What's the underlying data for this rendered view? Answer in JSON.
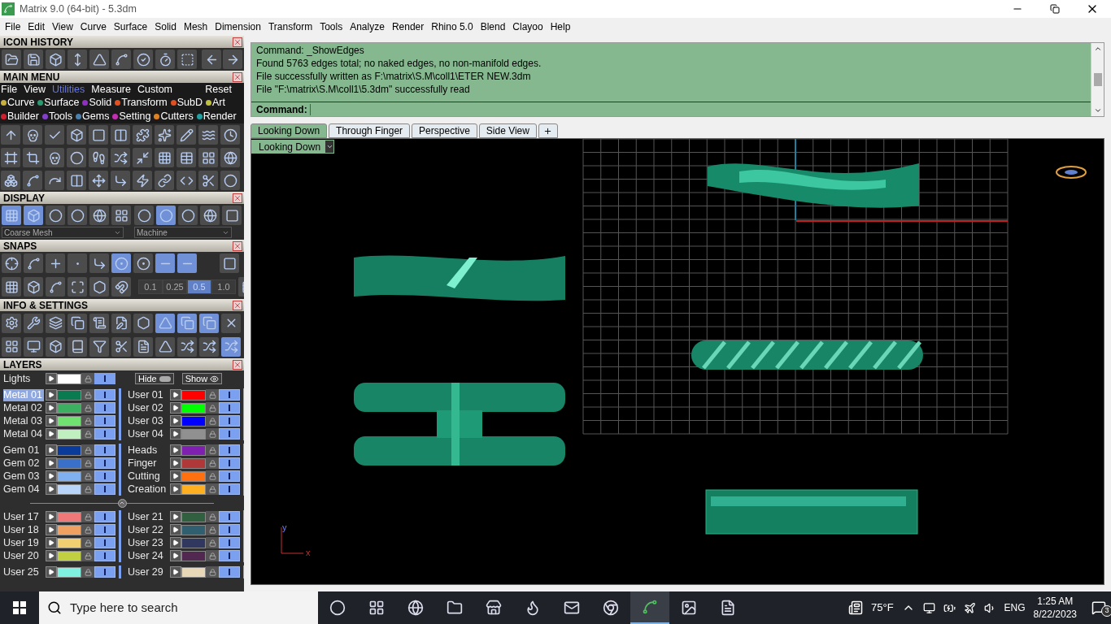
{
  "window": {
    "title": "Matrix 9.0 (64-bit) - 5.3dm"
  },
  "menu_bar": [
    "File",
    "Edit",
    "View",
    "Curve",
    "Surface",
    "Solid",
    "Mesh",
    "Dimension",
    "Transform",
    "Tools",
    "Analyze",
    "Render",
    "Rhino 5.0",
    "Blend",
    "Clayoo",
    "Help"
  ],
  "left_panel": {
    "icon_history": {
      "title": "ICON HISTORY"
    },
    "main_menu": {
      "title": "MAIN MENU",
      "tabs": [
        {
          "label": "File",
          "selected": false
        },
        {
          "label": "View",
          "selected": false
        },
        {
          "label": "Utilities",
          "selected": true
        },
        {
          "label": "Measure",
          "selected": false
        },
        {
          "label": "Custom",
          "selected": false
        }
      ],
      "reset": "Reset",
      "categories": [
        [
          {
            "label": "Curve",
            "color": "#c8b040"
          },
          {
            "label": "Surface",
            "color": "#2a9a70"
          },
          {
            "label": "Solid",
            "color": "#9030c0"
          },
          {
            "label": "Transform",
            "color": "#e05020"
          },
          {
            "label": "SubD",
            "color": "#e05020"
          },
          {
            "label": "Art",
            "color": "#c0c040"
          }
        ],
        [
          {
            "label": "Builder",
            "color": "#d02030"
          },
          {
            "label": "Tools",
            "color": "#8040c8"
          },
          {
            "label": "Gems",
            "color": "#4a80b0"
          },
          {
            "label": "Setting",
            "color": "#c030b0"
          },
          {
            "label": "Cutters",
            "color": "#e08020"
          },
          {
            "label": "Render",
            "color": "#20a0a0"
          }
        ]
      ]
    },
    "display": {
      "title": "DISPLAY",
      "dropdowns": [
        "Coarse Mesh",
        "Machine"
      ]
    },
    "snaps": {
      "title": "SNAPS",
      "values": [
        {
          "label": "0.1",
          "selected": false
        },
        {
          "label": "0.25",
          "selected": false
        },
        {
          "label": "0.5",
          "selected": true
        },
        {
          "label": "1.0",
          "selected": false
        }
      ]
    },
    "info": {
      "title": "INFO & SETTINGS"
    },
    "layers": {
      "title": "LAYERS",
      "lights": {
        "label": "Lights",
        "color": "#ffffff",
        "visible": true
      },
      "hide": "Hide",
      "show": "Show",
      "groups": [
        {
          "left": [
            {
              "name": "Metal 01",
              "color": "#0a7a50",
              "selected": true,
              "visible": true
            },
            {
              "name": "Metal 02",
              "color": "#3cb060",
              "selected": false,
              "visible": true
            },
            {
              "name": "Metal 03",
              "color": "#70e070",
              "selected": false,
              "visible": true
            },
            {
              "name": "Metal 04",
              "color": "#c0f0c0",
              "selected": false,
              "visible": true
            }
          ],
          "right": [
            {
              "name": "User 01",
              "color": "#ff0000",
              "selected": false,
              "visible": true
            },
            {
              "name": "User 02",
              "color": "#00ff00",
              "selected": false,
              "visible": true
            },
            {
              "name": "User 03",
              "color": "#0000ff",
              "selected": false,
              "visible": true
            },
            {
              "name": "User 04",
              "color": "#909090",
              "selected": false,
              "visible": true
            }
          ]
        },
        {
          "left": [
            {
              "name": "Gem 01",
              "color": "#0a3a9a",
              "selected": false,
              "visible": true
            },
            {
              "name": "Gem 02",
              "color": "#3a70c8",
              "selected": false,
              "visible": true
            },
            {
              "name": "Gem 03",
              "color": "#80b0f0",
              "selected": false,
              "visible": true
            },
            {
              "name": "Gem 04",
              "color": "#b8d4f8",
              "selected": false,
              "visible": true
            }
          ],
          "right": [
            {
              "name": "Heads",
              "color": "#8020b0",
              "selected": false,
              "visible": true
            },
            {
              "name": "Finger",
              "color": "#b03838",
              "selected": false,
              "visible": true
            },
            {
              "name": "Cutting",
              "color": "#ff7010",
              "selected": false,
              "visible": true
            },
            {
              "name": "Creation",
              "color": "#ffb020",
              "selected": false,
              "visible": true
            }
          ]
        },
        {
          "left": [
            {
              "name": "User 17",
              "color": "#f07878",
              "selected": false,
              "visible": true
            },
            {
              "name": "User 18",
              "color": "#f0a060",
              "selected": false,
              "visible": true
            },
            {
              "name": "User 19",
              "color": "#f0d070",
              "selected": false,
              "visible": true
            },
            {
              "name": "User 20",
              "color": "#c0d040",
              "selected": false,
              "visible": true
            }
          ],
          "right": [
            {
              "name": "User 21",
              "color": "#306040",
              "selected": false,
              "visible": true
            },
            {
              "name": "User 22",
              "color": "#306070",
              "selected": false,
              "visible": true
            },
            {
              "name": "User 23",
              "color": "#303860",
              "selected": false,
              "visible": true
            },
            {
              "name": "User 24",
              "color": "#502850",
              "selected": false,
              "visible": true
            }
          ]
        },
        {
          "left": [
            {
              "name": "User 25",
              "color": "#80f0e0",
              "selected": false,
              "visible": true
            }
          ],
          "right": [
            {
              "name": "User 29",
              "color": "#e8d8b8",
              "selected": false,
              "visible": true
            }
          ]
        }
      ]
    }
  },
  "command": {
    "lines": [
      "Command: _ShowEdges",
      "Found 5763 edges total; no naked edges, no non-manifold edges.",
      "File successfully written as F:\\matrix\\S.M\\coll1\\ETER NEW.3dm",
      "File \"F:\\matrix\\S.M\\coll1\\5.3dm\" successfully read"
    ],
    "prompt": "Command:"
  },
  "viewport_tabs": [
    {
      "label": "Looking Down",
      "selected": true
    },
    {
      "label": "Through Finger",
      "selected": false
    },
    {
      "label": "Perspective",
      "selected": false
    },
    {
      "label": "Side View",
      "selected": false
    }
  ],
  "viewport": {
    "view_menu": "Looking Down",
    "axis_labels": [
      "y",
      "x"
    ]
  },
  "taskbar": {
    "search_placeholder": "Type here to search",
    "weather": "75°F",
    "language": "ENG",
    "time": "1:25 AM",
    "date": "8/22/2023",
    "notifications": "3"
  }
}
